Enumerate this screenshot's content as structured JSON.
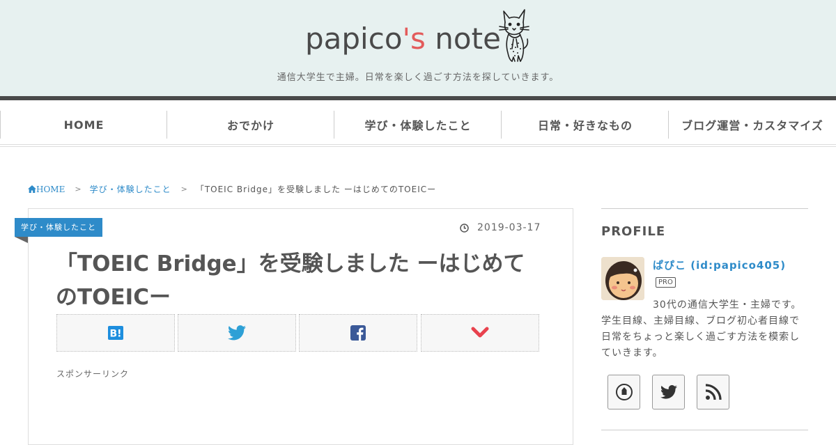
{
  "header": {
    "logo_main": "papico",
    "logo_accent": "'s",
    "logo_rest": " note",
    "tagline": "通信大学生で主婦。日常を楽しく過ごす方法を探していきます。",
    "accent_color": "#e35b5b",
    "background_color": "#e7f1f0"
  },
  "nav": {
    "items": [
      {
        "label": "HOME"
      },
      {
        "label": "おでかけ"
      },
      {
        "label": "学び・体験したこと"
      },
      {
        "label": "日常・好きなもの"
      },
      {
        "label": "ブログ運営・カスタマイズ"
      }
    ]
  },
  "breadcrumb": {
    "home": "HOME",
    "category": "学び・体験したこと",
    "current": "「TOEIC Bridge」を受験しました ーはじめてのTOEICー"
  },
  "article": {
    "category_label": "学び・体験したこと",
    "date": "2019-03-17",
    "title": "「TOEIC Bridge」を受験しました ーはじめてのTOEICー",
    "sponsor_text": "スポンサーリンク",
    "share_buttons": [
      {
        "icon": "hatena-bookmark-icon",
        "color": "#1d8ede"
      },
      {
        "icon": "twitter-icon",
        "color": "#2ea0d6"
      },
      {
        "icon": "facebook-icon",
        "color": "#3b5998"
      },
      {
        "icon": "pocket-icon",
        "color": "#e8424e"
      }
    ]
  },
  "sidebar": {
    "profile_heading": "PROFILE",
    "name": "ぱぴこ (id:papico405)",
    "badge": "PRO",
    "description": "30代の通信大学生・主婦です。学生目線、主婦目線、ブログ初心者目線で日常をちょっと楽しく過ごす方法を模索していきます。",
    "sns": [
      {
        "icon": "feedly-icon"
      },
      {
        "icon": "twitter-icon"
      },
      {
        "icon": "rss-icon"
      }
    ],
    "link_color": "#2e8bc9"
  }
}
